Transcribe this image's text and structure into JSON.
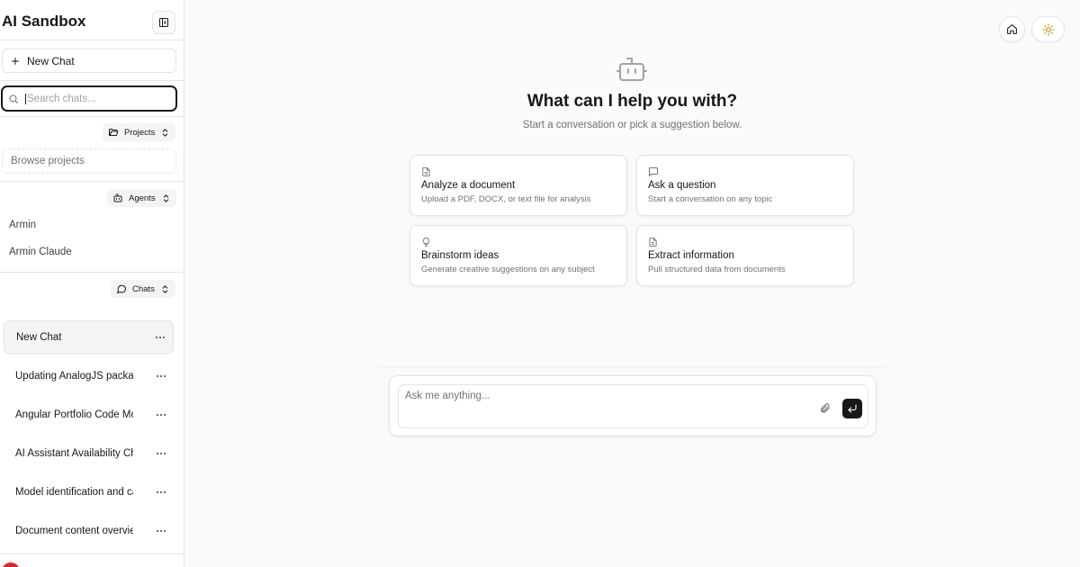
{
  "sidebar": {
    "app_title": "AI Sandbox",
    "new_chat_label": "New Chat",
    "search_placeholder": "Search chats...",
    "projects_label": "Projects",
    "browse_projects_label": "Browse projects",
    "agents_label": "Agents",
    "agents": [
      "Armin",
      "Armin Claude"
    ],
    "chats_label": "Chats",
    "chats": [
      {
        "title": "New Chat",
        "active": true
      },
      {
        "title": "Updating AnalogJS packages",
        "active": false
      },
      {
        "title": "Angular Portfolio Code Modernization",
        "active": false
      },
      {
        "title": "AI Assistant Availability Check",
        "active": false
      },
      {
        "title": "Model identification and capabilities",
        "active": false
      },
      {
        "title": "Document content overview",
        "active": false
      }
    ]
  },
  "main": {
    "hero_title": "What can I help you with?",
    "hero_subtitle": "Start a conversation or pick a suggestion below.",
    "suggestions": [
      {
        "icon": "document-icon",
        "title": "Analyze a document",
        "description": "Upload a PDF, DOCX, or text file for analysis"
      },
      {
        "icon": "message-icon",
        "title": "Ask a question",
        "description": "Start a conversation on any topic"
      },
      {
        "icon": "lightbulb-icon",
        "title": "Brainstorm ideas",
        "description": "Generate creative suggestions on any subject"
      },
      {
        "icon": "file-text-icon",
        "title": "Extract information",
        "description": "Pull structured data from documents"
      }
    ],
    "composer_placeholder": "Ask me anything..."
  },
  "colors": {
    "accent_dark": "#18181b",
    "muted_text": "#71717a",
    "border": "#e4e4e7",
    "main_bg": "#fafafa",
    "avatar": "#dc2626"
  }
}
